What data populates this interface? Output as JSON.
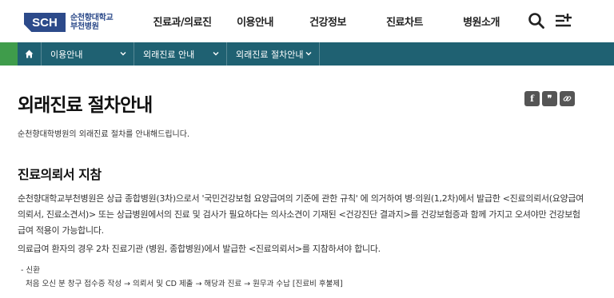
{
  "header": {
    "logo_mark": "SCH",
    "logo_line1": "순천향대학교",
    "logo_line2": "부천병원",
    "nav": [
      "진료과/의료진",
      "이용안내",
      "건강정보",
      "진료차트",
      "병원소개"
    ],
    "icons": [
      "search-icon",
      "menu-plus-icon"
    ]
  },
  "breadcrumb": {
    "home_icon": "home-icon",
    "items": [
      "이용안내",
      "외래진료 안내",
      "외래진료 절차안내"
    ]
  },
  "colors": {
    "accent_green": "#43a047",
    "accent_teal": "#1e5d72",
    "crumb_bar": "#1f6172",
    "brand_blue": "#2c4a8a"
  },
  "content": {
    "title": "외래진료 절차안내",
    "share": [
      "f",
      "❞",
      "link-icon"
    ],
    "intro": "순천향대학병원의 외래진료 절차를 안내해드립니다.",
    "section_title": "진료의뢰서 지참",
    "para1": "순천향대학교부천병원은 상급 종합병원(3차)으로서 '국민건강보험 요양급여의 기준에 관한 규칙' 에 의거하여 병·의원(1,2차)에서 발급한 <진료의뢰서(요양급여의뢰서, 진료소견서)> 또는 상급병원에서의 진료 및 검사가 필요하다는 의사소견이 기재된 <건강진단 결과지>를 건강보험증과 함께 가지고 오셔야만 건강보험급여 적용이 가능합니다.",
    "para2": "의료급여 환자의 경우 2차 진료기관 (병원, 종합병원)에서 발급한 <진료의뢰서>를 지참하셔야 합니다.",
    "sub_label": "- 신환",
    "sub_text": "처음 오신 분 창구 접수증 작성 → 의뢰서 및 CD 제출 → 해당과 진료 → 원무과 수납 [진료비 후불제]"
  }
}
